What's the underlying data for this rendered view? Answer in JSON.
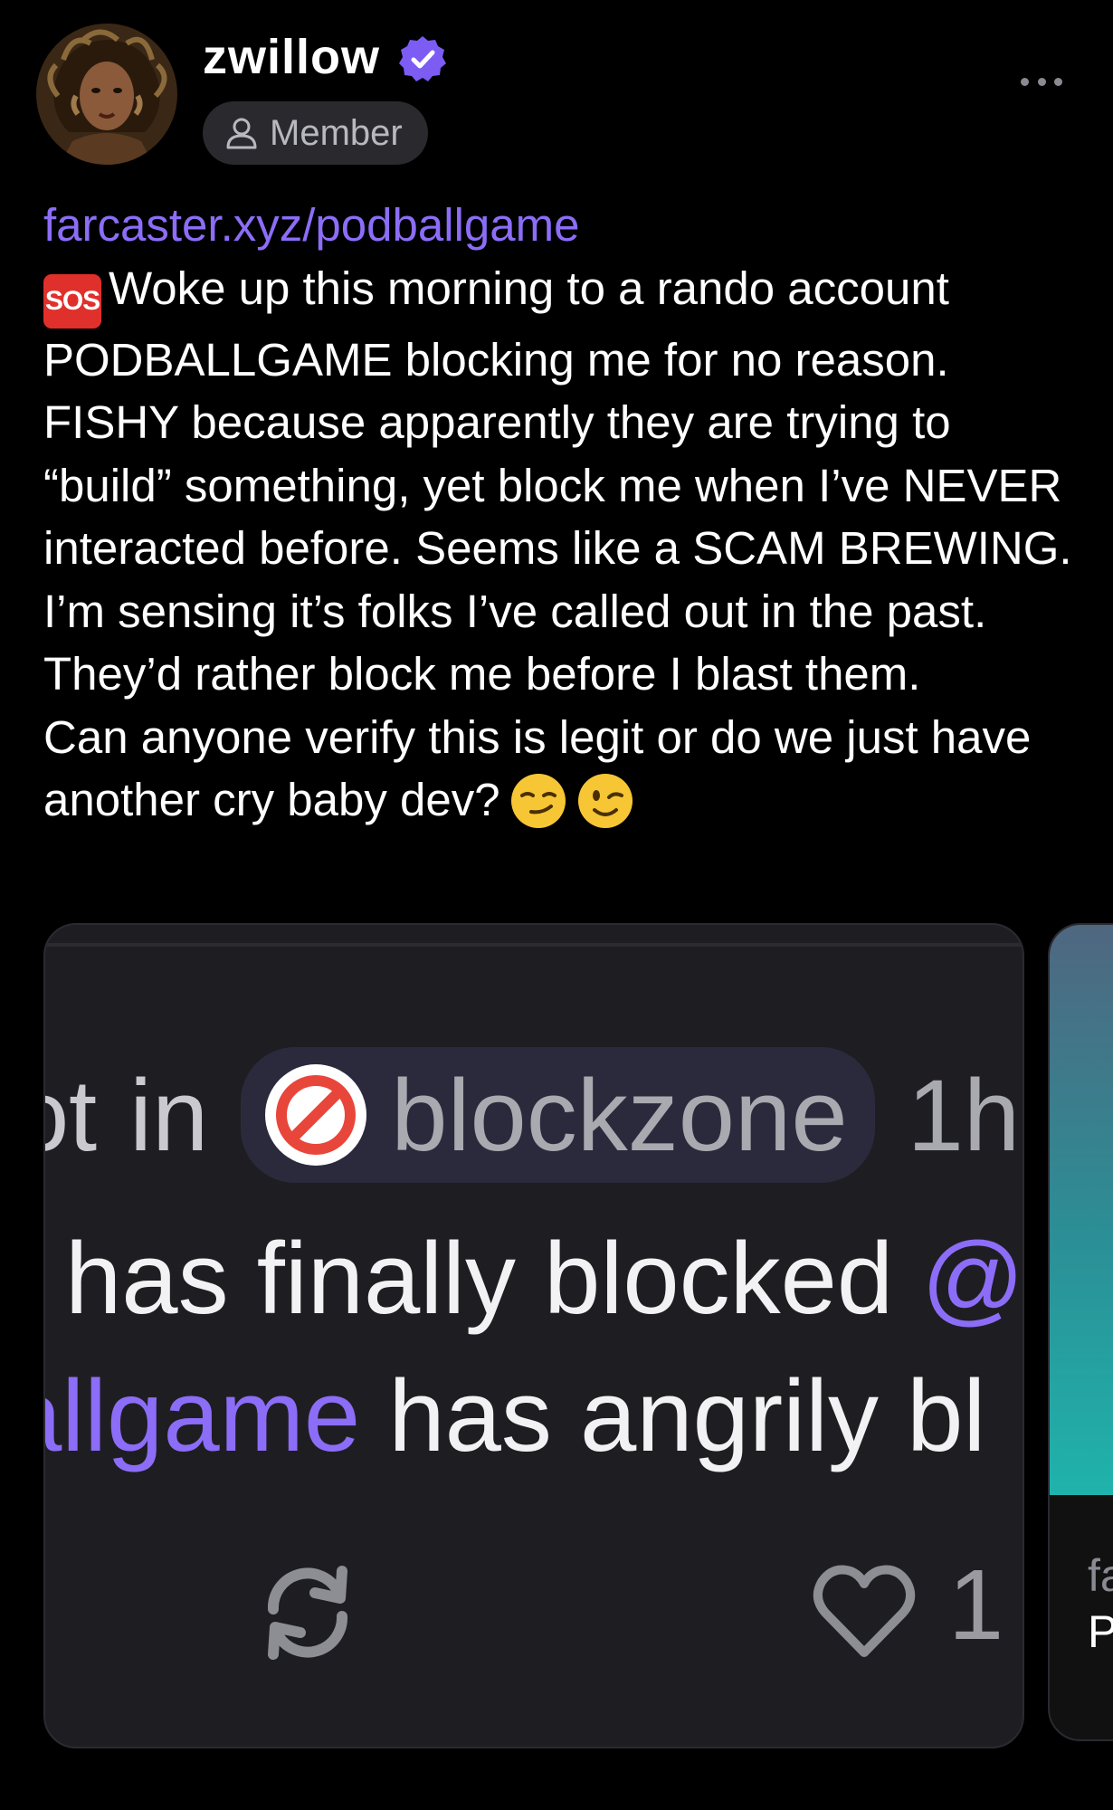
{
  "author": {
    "username": "zwillow",
    "verified": true,
    "role_badge": "Member",
    "avatar_icon": "avatar-portrait"
  },
  "post": {
    "link": "farcaster.xyz/podballgame",
    "sos_badge": "SOS",
    "paragraph1": "Woke up this morning to a rando account PODBALLGAME blocking me for no reason. FISHY because apparently they are trying to “build” something, yet block me when I’ve NEVER interacted before. Seems like a SCAM BREWING. I’m sensing it’s folks I’ve called out in the past. They’d rather block me before I blast them.",
    "paragraph2": "Can anyone verify this is legit or do we just have another cry baby dev?",
    "emojis": [
      "smirking-face-emoji",
      "winking-face-emoji"
    ]
  },
  "embed_image": {
    "row1_prefix": "ɔt",
    "row1_in": "in",
    "channel": "blockzone",
    "row1_suffix": "1h",
    "row2_text": "has finally blocked",
    "row2_at": "@",
    "row3_handle": "allgame",
    "row3_text": "has angrily bl",
    "like_count": "1"
  },
  "embed_image2": {
    "line1": "fa",
    "line2": "P"
  },
  "colors": {
    "background": "#000000",
    "accent": "#8c6df7",
    "badge_bg": "#2a2a2e",
    "sos_red": "#e0302b",
    "block_red": "#e8463a"
  }
}
